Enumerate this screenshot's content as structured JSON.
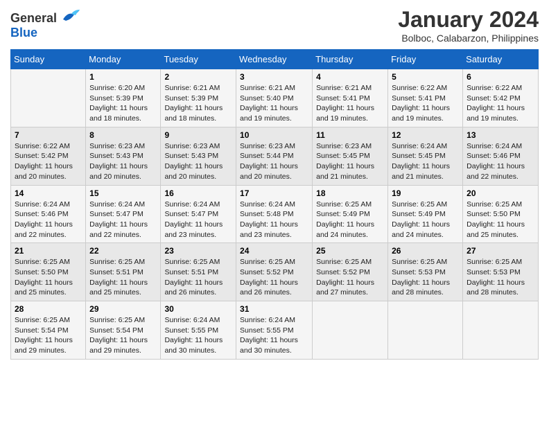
{
  "logo": {
    "text_general": "General",
    "text_blue": "Blue"
  },
  "title": "January 2024",
  "subtitle": "Bolboc, Calabarzon, Philippines",
  "days_of_week": [
    "Sunday",
    "Monday",
    "Tuesday",
    "Wednesday",
    "Thursday",
    "Friday",
    "Saturday"
  ],
  "weeks": [
    [
      {
        "day": "",
        "sunrise": "",
        "sunset": "",
        "daylight": ""
      },
      {
        "day": "1",
        "sunrise": "Sunrise: 6:20 AM",
        "sunset": "Sunset: 5:39 PM",
        "daylight": "Daylight: 11 hours and 18 minutes."
      },
      {
        "day": "2",
        "sunrise": "Sunrise: 6:21 AM",
        "sunset": "Sunset: 5:39 PM",
        "daylight": "Daylight: 11 hours and 18 minutes."
      },
      {
        "day": "3",
        "sunrise": "Sunrise: 6:21 AM",
        "sunset": "Sunset: 5:40 PM",
        "daylight": "Daylight: 11 hours and 19 minutes."
      },
      {
        "day": "4",
        "sunrise": "Sunrise: 6:21 AM",
        "sunset": "Sunset: 5:41 PM",
        "daylight": "Daylight: 11 hours and 19 minutes."
      },
      {
        "day": "5",
        "sunrise": "Sunrise: 6:22 AM",
        "sunset": "Sunset: 5:41 PM",
        "daylight": "Daylight: 11 hours and 19 minutes."
      },
      {
        "day": "6",
        "sunrise": "Sunrise: 6:22 AM",
        "sunset": "Sunset: 5:42 PM",
        "daylight": "Daylight: 11 hours and 19 minutes."
      }
    ],
    [
      {
        "day": "7",
        "sunrise": "Sunrise: 6:22 AM",
        "sunset": "Sunset: 5:42 PM",
        "daylight": "Daylight: 11 hours and 20 minutes."
      },
      {
        "day": "8",
        "sunrise": "Sunrise: 6:23 AM",
        "sunset": "Sunset: 5:43 PM",
        "daylight": "Daylight: 11 hours and 20 minutes."
      },
      {
        "day": "9",
        "sunrise": "Sunrise: 6:23 AM",
        "sunset": "Sunset: 5:43 PM",
        "daylight": "Daylight: 11 hours and 20 minutes."
      },
      {
        "day": "10",
        "sunrise": "Sunrise: 6:23 AM",
        "sunset": "Sunset: 5:44 PM",
        "daylight": "Daylight: 11 hours and 20 minutes."
      },
      {
        "day": "11",
        "sunrise": "Sunrise: 6:23 AM",
        "sunset": "Sunset: 5:45 PM",
        "daylight": "Daylight: 11 hours and 21 minutes."
      },
      {
        "day": "12",
        "sunrise": "Sunrise: 6:24 AM",
        "sunset": "Sunset: 5:45 PM",
        "daylight": "Daylight: 11 hours and 21 minutes."
      },
      {
        "day": "13",
        "sunrise": "Sunrise: 6:24 AM",
        "sunset": "Sunset: 5:46 PM",
        "daylight": "Daylight: 11 hours and 22 minutes."
      }
    ],
    [
      {
        "day": "14",
        "sunrise": "Sunrise: 6:24 AM",
        "sunset": "Sunset: 5:46 PM",
        "daylight": "Daylight: 11 hours and 22 minutes."
      },
      {
        "day": "15",
        "sunrise": "Sunrise: 6:24 AM",
        "sunset": "Sunset: 5:47 PM",
        "daylight": "Daylight: 11 hours and 22 minutes."
      },
      {
        "day": "16",
        "sunrise": "Sunrise: 6:24 AM",
        "sunset": "Sunset: 5:47 PM",
        "daylight": "Daylight: 11 hours and 23 minutes."
      },
      {
        "day": "17",
        "sunrise": "Sunrise: 6:24 AM",
        "sunset": "Sunset: 5:48 PM",
        "daylight": "Daylight: 11 hours and 23 minutes."
      },
      {
        "day": "18",
        "sunrise": "Sunrise: 6:25 AM",
        "sunset": "Sunset: 5:49 PM",
        "daylight": "Daylight: 11 hours and 24 minutes."
      },
      {
        "day": "19",
        "sunrise": "Sunrise: 6:25 AM",
        "sunset": "Sunset: 5:49 PM",
        "daylight": "Daylight: 11 hours and 24 minutes."
      },
      {
        "day": "20",
        "sunrise": "Sunrise: 6:25 AM",
        "sunset": "Sunset: 5:50 PM",
        "daylight": "Daylight: 11 hours and 25 minutes."
      }
    ],
    [
      {
        "day": "21",
        "sunrise": "Sunrise: 6:25 AM",
        "sunset": "Sunset: 5:50 PM",
        "daylight": "Daylight: 11 hours and 25 minutes."
      },
      {
        "day": "22",
        "sunrise": "Sunrise: 6:25 AM",
        "sunset": "Sunset: 5:51 PM",
        "daylight": "Daylight: 11 hours and 25 minutes."
      },
      {
        "day": "23",
        "sunrise": "Sunrise: 6:25 AM",
        "sunset": "Sunset: 5:51 PM",
        "daylight": "Daylight: 11 hours and 26 minutes."
      },
      {
        "day": "24",
        "sunrise": "Sunrise: 6:25 AM",
        "sunset": "Sunset: 5:52 PM",
        "daylight": "Daylight: 11 hours and 26 minutes."
      },
      {
        "day": "25",
        "sunrise": "Sunrise: 6:25 AM",
        "sunset": "Sunset: 5:52 PM",
        "daylight": "Daylight: 11 hours and 27 minutes."
      },
      {
        "day": "26",
        "sunrise": "Sunrise: 6:25 AM",
        "sunset": "Sunset: 5:53 PM",
        "daylight": "Daylight: 11 hours and 28 minutes."
      },
      {
        "day": "27",
        "sunrise": "Sunrise: 6:25 AM",
        "sunset": "Sunset: 5:53 PM",
        "daylight": "Daylight: 11 hours and 28 minutes."
      }
    ],
    [
      {
        "day": "28",
        "sunrise": "Sunrise: 6:25 AM",
        "sunset": "Sunset: 5:54 PM",
        "daylight": "Daylight: 11 hours and 29 minutes."
      },
      {
        "day": "29",
        "sunrise": "Sunrise: 6:25 AM",
        "sunset": "Sunset: 5:54 PM",
        "daylight": "Daylight: 11 hours and 29 minutes."
      },
      {
        "day": "30",
        "sunrise": "Sunrise: 6:24 AM",
        "sunset": "Sunset: 5:55 PM",
        "daylight": "Daylight: 11 hours and 30 minutes."
      },
      {
        "day": "31",
        "sunrise": "Sunrise: 6:24 AM",
        "sunset": "Sunset: 5:55 PM",
        "daylight": "Daylight: 11 hours and 30 minutes."
      },
      {
        "day": "",
        "sunrise": "",
        "sunset": "",
        "daylight": ""
      },
      {
        "day": "",
        "sunrise": "",
        "sunset": "",
        "daylight": ""
      },
      {
        "day": "",
        "sunrise": "",
        "sunset": "",
        "daylight": ""
      }
    ]
  ]
}
